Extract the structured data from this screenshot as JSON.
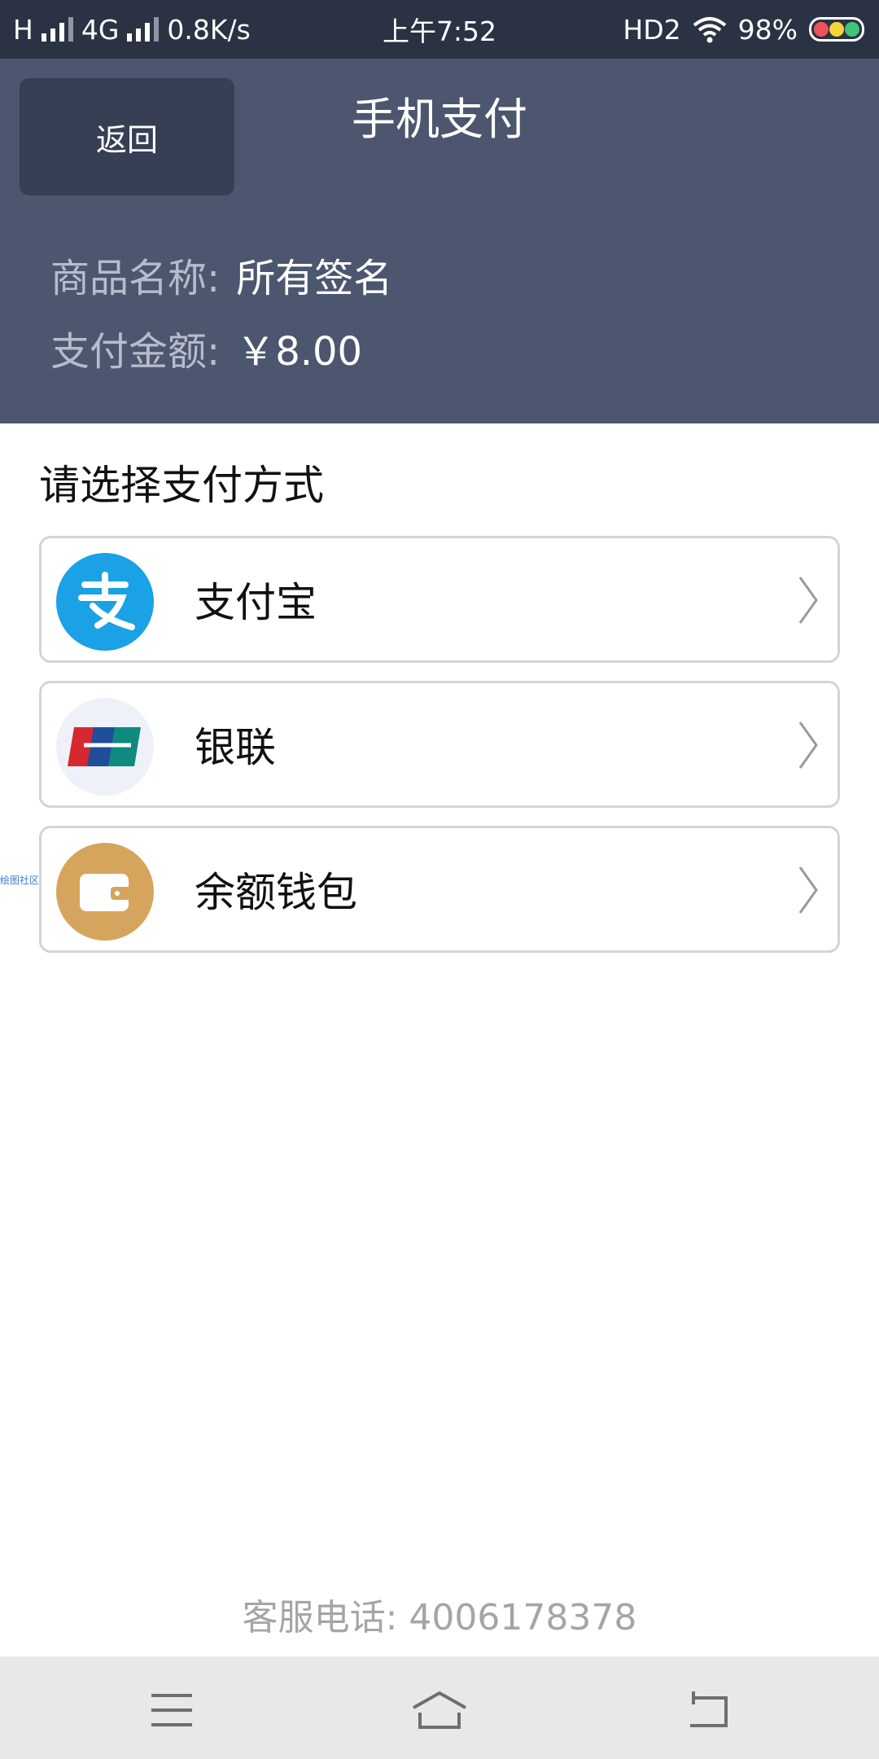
{
  "status_bar": {
    "network_left": "H",
    "network_type": "4G",
    "speed": "0.8K/s",
    "time": "上午7:52",
    "hd_label": "HD2",
    "battery_percent": "98%"
  },
  "header": {
    "back_label": "返回",
    "title": "手机支付",
    "product_label": "商品名称:",
    "product_value": "所有签名",
    "amount_label": "支付金额:",
    "amount_value": "￥8.00"
  },
  "payment": {
    "section_title": "请选择支付方式",
    "methods": [
      {
        "label": "支付宝",
        "icon": "alipay-icon",
        "color": "#1aa1e6"
      },
      {
        "label": "银联",
        "icon": "unionpay-icon",
        "color": "#eef1f7"
      },
      {
        "label": "余额钱包",
        "icon": "wallet-icon",
        "color": "#d6a55d"
      }
    ],
    "side_text": "绘图社区"
  },
  "footer": {
    "service_phone": "客服电话: 4006178378"
  },
  "nav_bar": {
    "icons": [
      "menu-icon",
      "home-icon",
      "back-icon"
    ]
  },
  "colors": {
    "status_bar_bg": "#2b3243",
    "header_bg": "#4c566e",
    "back_button_bg": "#363f53"
  }
}
